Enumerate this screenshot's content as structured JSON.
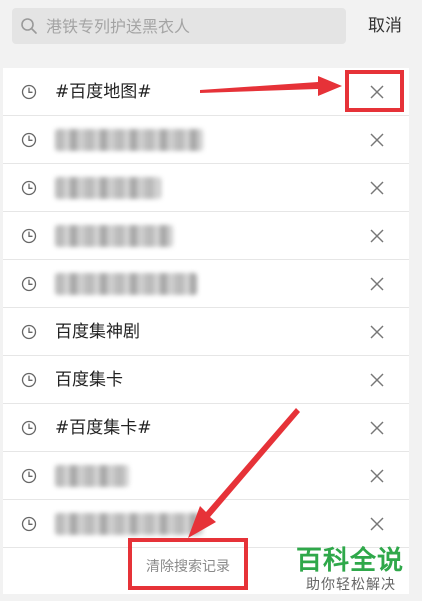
{
  "search": {
    "placeholder": "港铁专列护送黑衣人",
    "value": ""
  },
  "header": {
    "cancel_label": "取消"
  },
  "history": [
    {
      "text": "#百度地图#",
      "blurred": false
    },
    {
      "text": "",
      "blurred": true
    },
    {
      "text": "",
      "blurred": true
    },
    {
      "text": "",
      "blurred": true
    },
    {
      "text": "",
      "blurred": true
    },
    {
      "text": "百度集神剧",
      "blurred": false
    },
    {
      "text": "百度集卡",
      "blurred": false
    },
    {
      "text": "#百度集卡#",
      "blurred": false
    },
    {
      "text": "",
      "blurred": true
    },
    {
      "text": "",
      "blurred": true
    }
  ],
  "footer": {
    "clear_label": "清除搜索记录"
  },
  "watermark": {
    "title": "百科全说",
    "subtitle": "助你轻松解决"
  },
  "colors": {
    "annotation": "#e63238",
    "watermark": "#2fa84a"
  },
  "icons": {
    "search": "search-icon",
    "history": "clock-icon",
    "delete": "close-icon"
  }
}
